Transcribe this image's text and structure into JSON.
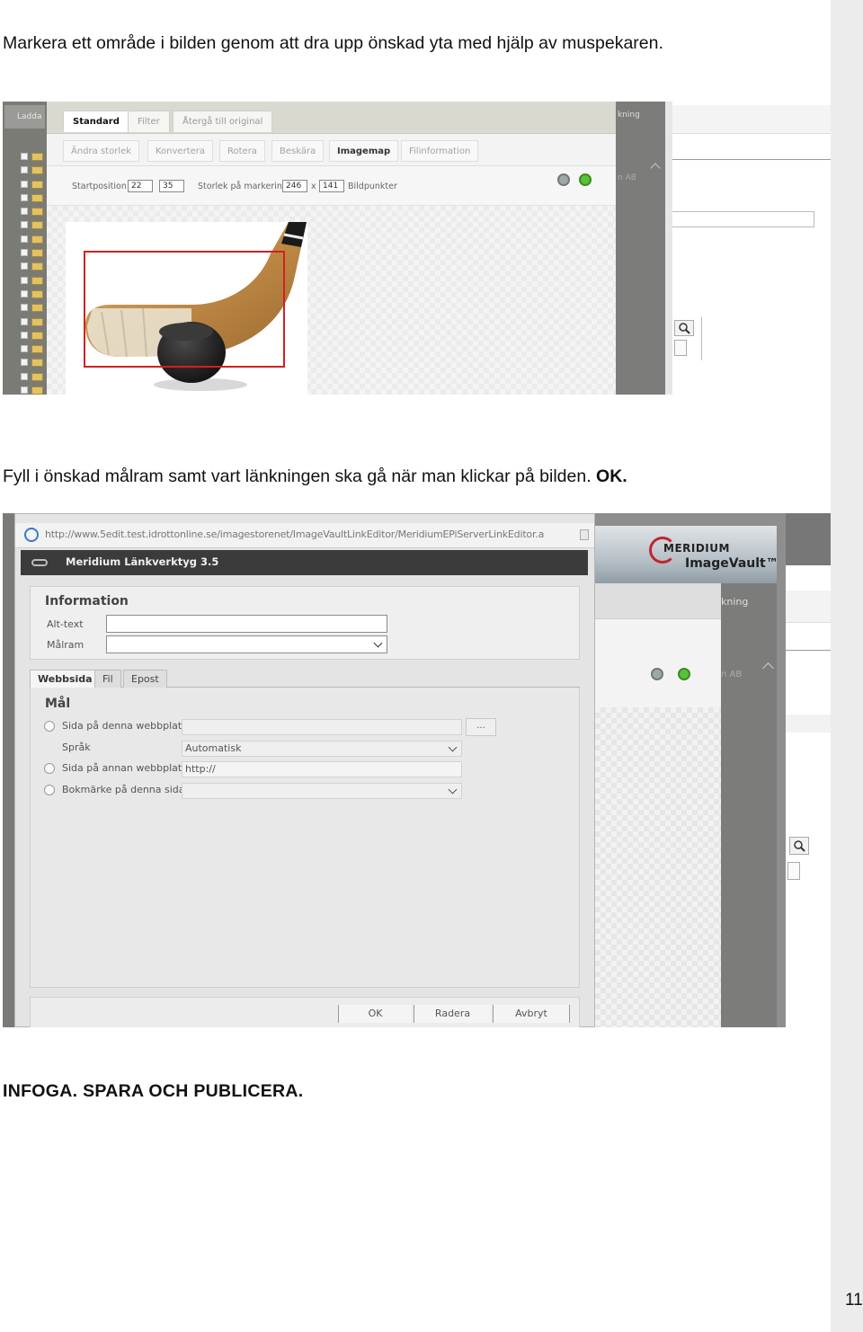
{
  "document": {
    "instruction_1": "Markera ett område i bilden genom att dra upp önskad yta med hjälp av muspekaren.",
    "instruction_2_text": "Fyll i önskad målram samt vart länkningen ska gå när man klickar på bilden.",
    "instruction_2_emphasis": "OK.",
    "instruction_3": "INFOGA. SPARA OCH PUBLICERA.",
    "page_number": "11"
  },
  "editor": {
    "tree_header": "Ladda",
    "tabs": [
      {
        "label": "Standard"
      },
      {
        "label": "Filter"
      },
      {
        "label": "Återgå till original"
      }
    ],
    "tools": [
      {
        "label": "Ändra storlek"
      },
      {
        "label": "Konvertera"
      },
      {
        "label": "Rotera"
      },
      {
        "label": "Beskära"
      },
      {
        "label": "Imagemap"
      },
      {
        "label": "Filinformation"
      }
    ],
    "start_label": "Startposition:",
    "start_x": "22",
    "start_y": "35",
    "size_label": "Storlek på markering:",
    "size_w": "246",
    "size_sep": "x",
    "size_h": "141",
    "size_unit": "Bildpunkter",
    "side_text": "kning",
    "side_text_2": "n AB",
    "colors": {
      "selection": "#d42020"
    }
  },
  "link_dialog": {
    "url": "http://www.5edit.test.idrottonline.se/imagestorenet/ImageVaultLinkEditor/MeridiumEPiServerLinkEditor.a",
    "title": "Meridium Länkverktyg 3.5",
    "info_title": "Information",
    "alt_label": "Alt-text",
    "alt_value": "",
    "target_label": "Målram",
    "target_value": "",
    "tabs": [
      {
        "label": "Webbsida"
      },
      {
        "label": "Fil"
      },
      {
        "label": "Epost"
      }
    ],
    "goal_title": "Mål",
    "options": {
      "this_site": "Sida på denna webbplats",
      "language_label": "Språk",
      "language_value": "Automatisk",
      "other_site": "Sida på annan webbplats",
      "other_site_value": "http://",
      "bookmark": "Bokmärke på denna sida",
      "browse": "..."
    },
    "buttons": {
      "ok": "OK",
      "delete": "Radera",
      "cancel": "Avbryt"
    },
    "brand_1": "MERIDIUM",
    "brand_2": "ImageVault™",
    "side_text": "kning",
    "side_text_2": "n AB"
  }
}
